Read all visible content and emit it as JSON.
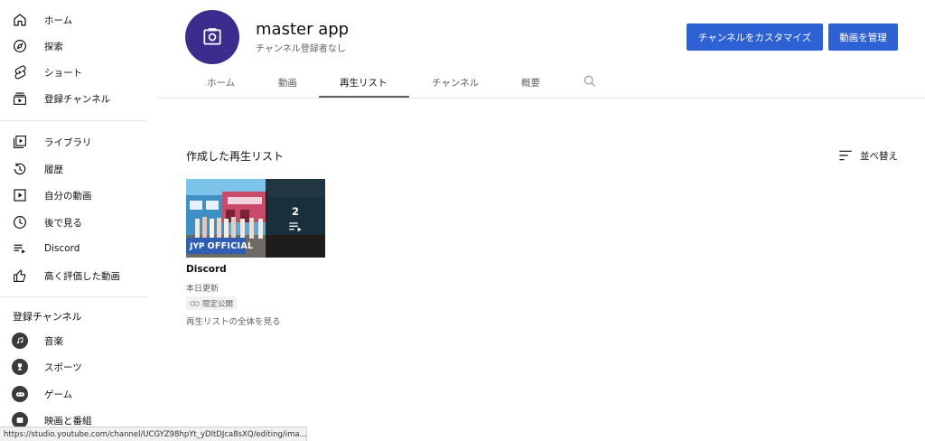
{
  "sidebar": {
    "main": [
      {
        "label": "ホーム",
        "icon": "home-icon"
      },
      {
        "label": "探索",
        "icon": "compass-icon"
      },
      {
        "label": "ショート",
        "icon": "shorts-icon"
      },
      {
        "label": "登録チャンネル",
        "icon": "subscriptions-icon"
      }
    ],
    "library": [
      {
        "label": "ライブラリ",
        "icon": "library-icon"
      },
      {
        "label": "履歴",
        "icon": "history-icon"
      },
      {
        "label": "自分の動画",
        "icon": "play-square-icon"
      },
      {
        "label": "後で見る",
        "icon": "clock-icon"
      },
      {
        "label": "Discord",
        "icon": "playlist-icon"
      },
      {
        "label": "高く評価した動画",
        "icon": "thumbs-up-icon"
      }
    ],
    "subscriptions_title": "登録チャンネル",
    "subscriptions": [
      {
        "label": "音楽",
        "icon": "music-icon"
      },
      {
        "label": "スポーツ",
        "icon": "trophy-icon"
      },
      {
        "label": "ゲーム",
        "icon": "gamepad-icon"
      },
      {
        "label": "映画と番組",
        "icon": "film-icon"
      }
    ]
  },
  "channel": {
    "name": "master app",
    "subtitle": "チャンネル登録者なし",
    "customize_label": "チャンネルをカスタマイズ",
    "manage_label": "動画を管理",
    "accent_color": "#2e62d4",
    "avatar_color": "#3d2c8d"
  },
  "tabs": [
    {
      "label": "ホーム",
      "active": false
    },
    {
      "label": "動画",
      "active": false
    },
    {
      "label": "再生リスト",
      "active": true
    },
    {
      "label": "チャンネル",
      "active": false
    },
    {
      "label": "概要",
      "active": false
    }
  ],
  "content": {
    "heading": "作成した再生リスト",
    "sort_label": "並べ替え",
    "playlist": {
      "video_count": "2",
      "thumbnail_badge": "OFFICIAL",
      "thumbnail_logo": "JYP",
      "title": "Discord",
      "updated": "本日更新",
      "visibility": "限定公開",
      "view_all": "再生リストの全体を見る"
    }
  },
  "statusbar": {
    "url": "https://studio.youtube.com/channel/UCGYZ98hpYt_yDltDJca8sXQ/editing/ima..."
  }
}
